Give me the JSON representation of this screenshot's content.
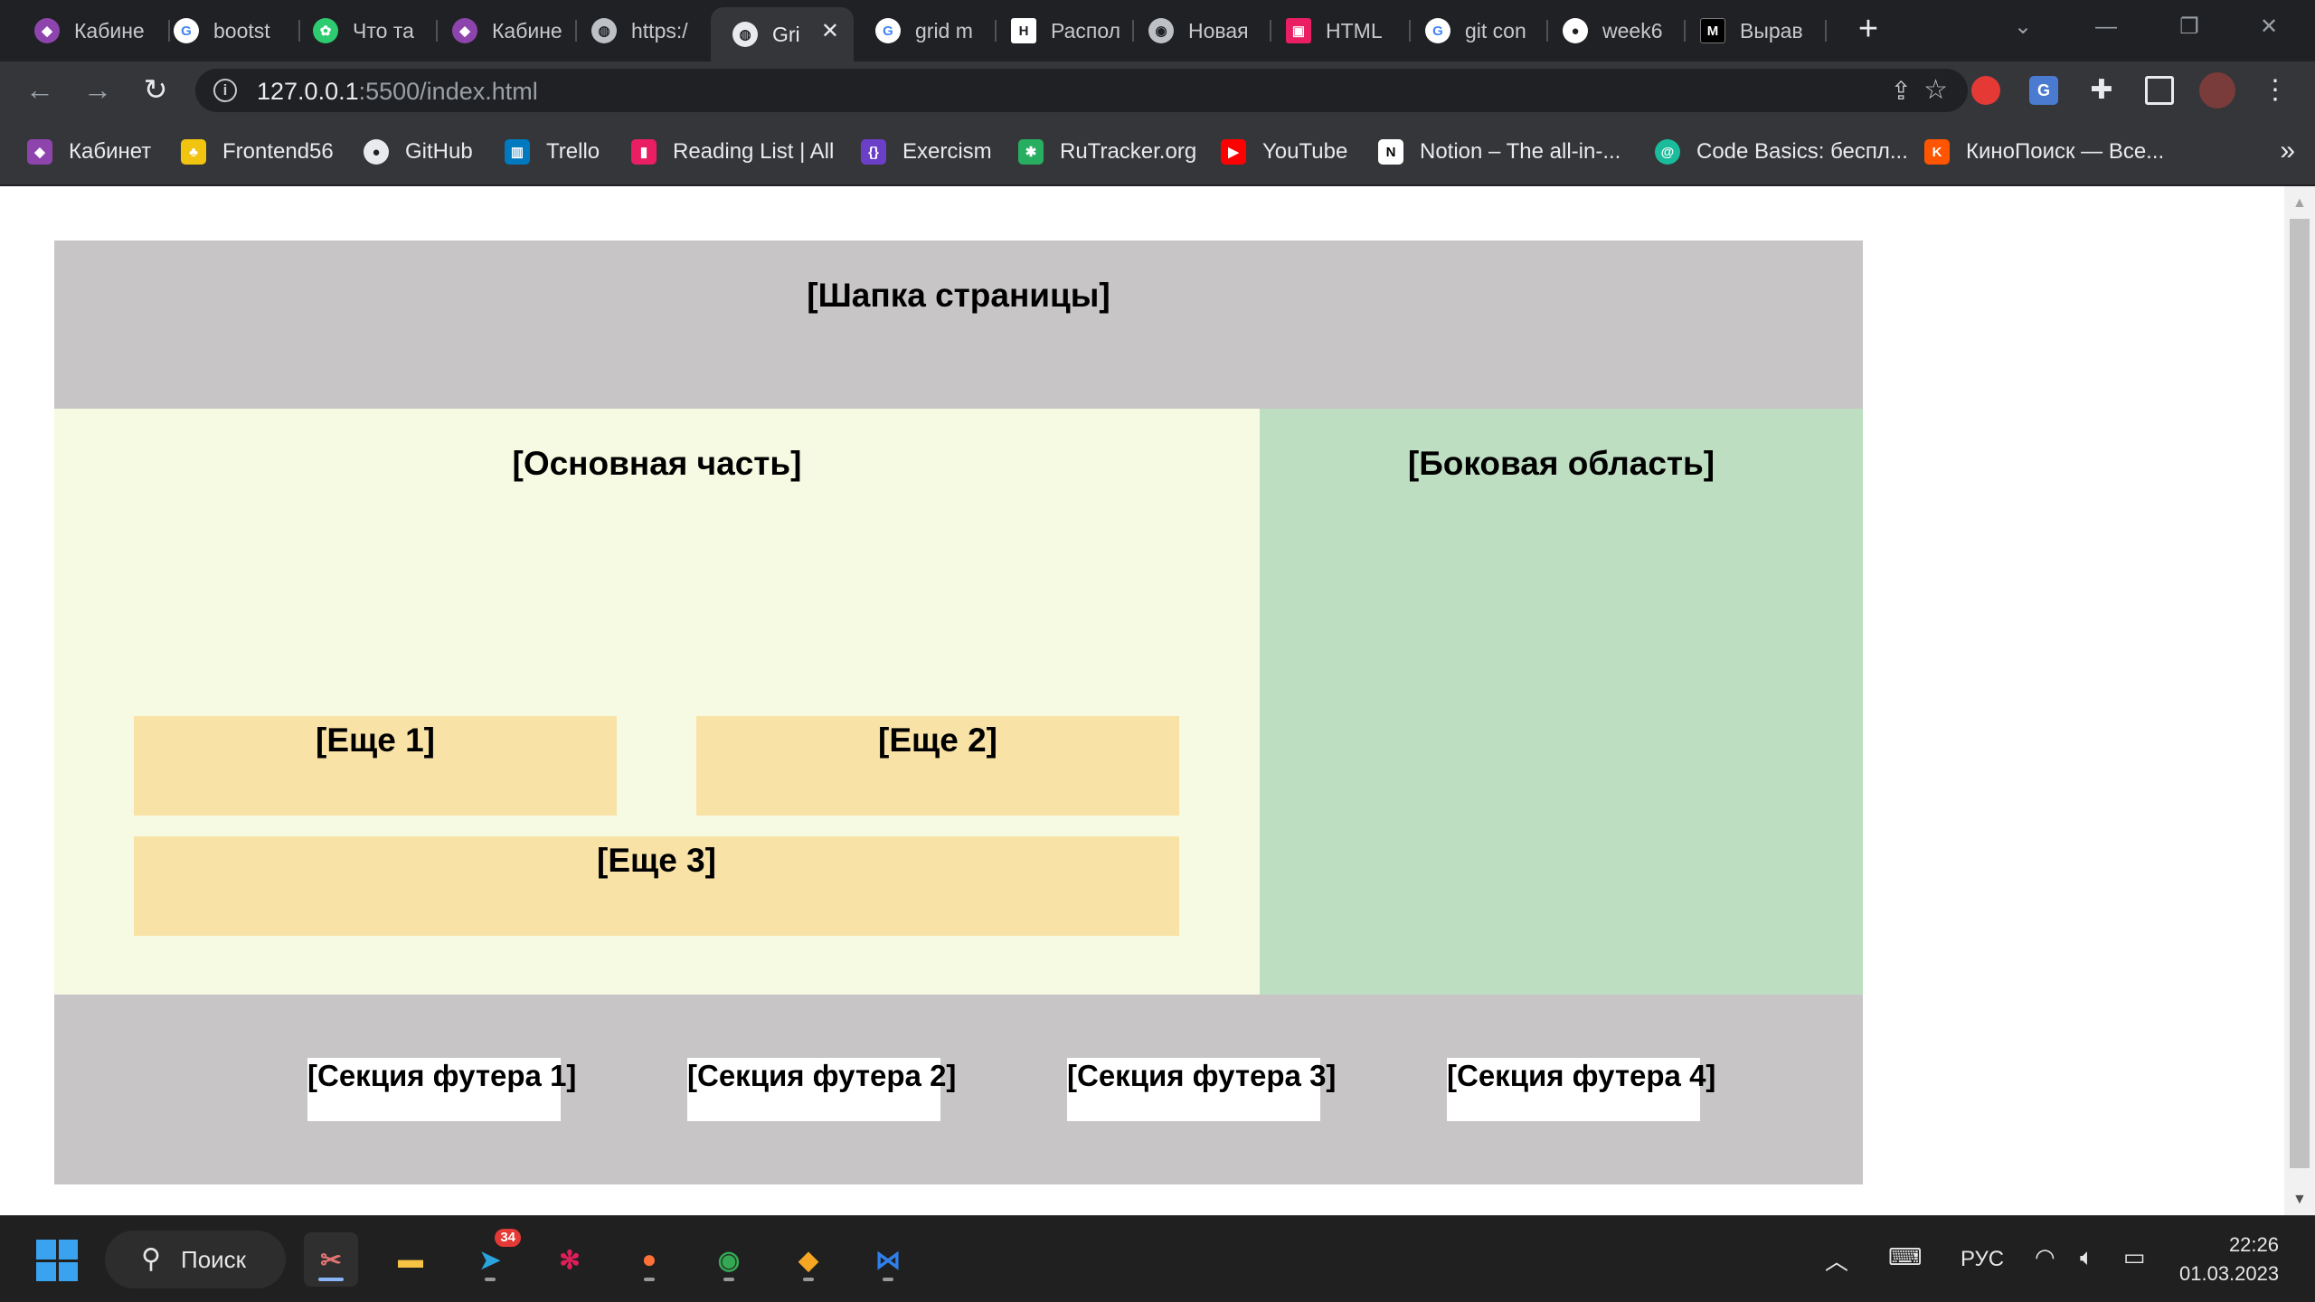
{
  "browser": {
    "tabs": [
      {
        "label": "Кабине",
        "icon": "purple-logo-icon",
        "color": "#8e44ad",
        "active": false
      },
      {
        "label": "bootst",
        "icon": "google-icon",
        "color": "#ffffff",
        "active": false
      },
      {
        "label": "Что та",
        "icon": "leaf-icon",
        "color": "#2ecc71",
        "active": false
      },
      {
        "label": "Кабине",
        "icon": "purple-logo-icon",
        "color": "#8e44ad",
        "active": false
      },
      {
        "label": "https:/",
        "icon": "globe-icon",
        "color": "#bdc1c6",
        "active": false
      },
      {
        "label": "Gri",
        "icon": "globe-icon",
        "color": "#e8eaed",
        "active": true
      },
      {
        "label": "grid m",
        "icon": "google-icon",
        "color": "#ffffff",
        "active": false
      },
      {
        "label": "Распол",
        "icon": "h-logo-icon",
        "color": "#ffffff",
        "active": false
      },
      {
        "label": "Новая",
        "icon": "chrome-icon",
        "color": "#bdc1c6",
        "active": false
      },
      {
        "label": "HTML",
        "icon": "htmlacademy-icon",
        "color": "#e91e63",
        "active": false
      },
      {
        "label": "git con",
        "icon": "google-icon",
        "color": "#ffffff",
        "active": false
      },
      {
        "label": "week6",
        "icon": "github-icon",
        "color": "#ffffff",
        "active": false
      },
      {
        "label": "Вырав",
        "icon": "m-logo-icon",
        "color": "#000000",
        "active": false
      }
    ],
    "new_tab_label": "+",
    "url_host": "127.0.0.1",
    "url_rest": ":5500/index.html",
    "bookmarks": [
      {
        "label": "Кабинет",
        "icon": "purple-logo-icon",
        "color": "#8e44ad"
      },
      {
        "label": "Frontend56",
        "icon": "pineapple-icon",
        "color": "#f1c40f"
      },
      {
        "label": "GitHub",
        "icon": "github-icon",
        "color": "#24292e"
      },
      {
        "label": "Trello",
        "icon": "trello-icon",
        "color": "#0079bf"
      },
      {
        "label": "Reading List | All",
        "icon": "bookmark-icon",
        "color": "#e91e63"
      },
      {
        "label": "Exercism",
        "icon": "exercism-icon",
        "color": "#6c3fc9"
      },
      {
        "label": "RuTracker.org",
        "icon": "rutracker-icon",
        "color": "#27ae60"
      },
      {
        "label": "YouTube",
        "icon": "youtube-icon",
        "color": "#ff0000"
      },
      {
        "label": "Notion – The all-in-...",
        "icon": "notion-icon",
        "color": "#000000"
      },
      {
        "label": "Code Basics: беспл...",
        "icon": "codebasics-icon",
        "color": "#1abc9c"
      },
      {
        "label": "КиноПоиск — Все...",
        "icon": "kinopoisk-icon",
        "color": "#ff5500"
      }
    ],
    "bookmarks_more": "»"
  },
  "page": {
    "header": "[Шапка страницы]",
    "main": "[Основная часть]",
    "aside": "[Боковая область]",
    "more1": "[Еще 1]",
    "more2": "[Еще 2]",
    "more3": "[Еще 3]",
    "footer_sections": [
      "[Секция футера 1]",
      "[Секция футера 2]",
      "[Секция футера 3]",
      "[Секция футера 4]"
    ],
    "colors": {
      "header": "#c7c5c6",
      "main": "#f7fae2",
      "aside": "#bedec2",
      "more": "#f8e2a6",
      "footer": "#c7c5c6"
    }
  },
  "taskbar": {
    "search_label": "Поиск",
    "telegram_badge": "34",
    "language": "РУС",
    "time": "22:26",
    "date": "01.03.2023"
  }
}
